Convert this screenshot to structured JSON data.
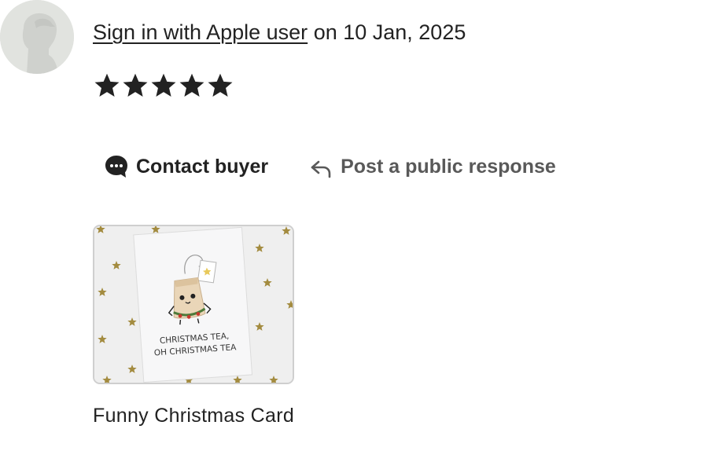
{
  "review": {
    "reviewer_name": "Sign in with Apple user",
    "date_text": "on 10 Jan, 2025",
    "rating": 5,
    "rating_max": 5
  },
  "actions": {
    "contact_label": "Contact buyer",
    "contact_icon": "chat-bubble-icon",
    "respond_label": "Post a public response",
    "respond_icon": "reply-arrow-icon"
  },
  "product": {
    "title": "Funny Christmas Card",
    "image_text_line1": "CHRISTMAS TEA,",
    "image_text_line2": "OH CHRISTMAS TEA"
  },
  "colors": {
    "text_primary": "#222222",
    "text_secondary": "#595959",
    "star": "#222222",
    "avatar_bg": "#e1e3df",
    "thumb_border": "#cfcfcf",
    "gold_star": "#a38b3f"
  }
}
